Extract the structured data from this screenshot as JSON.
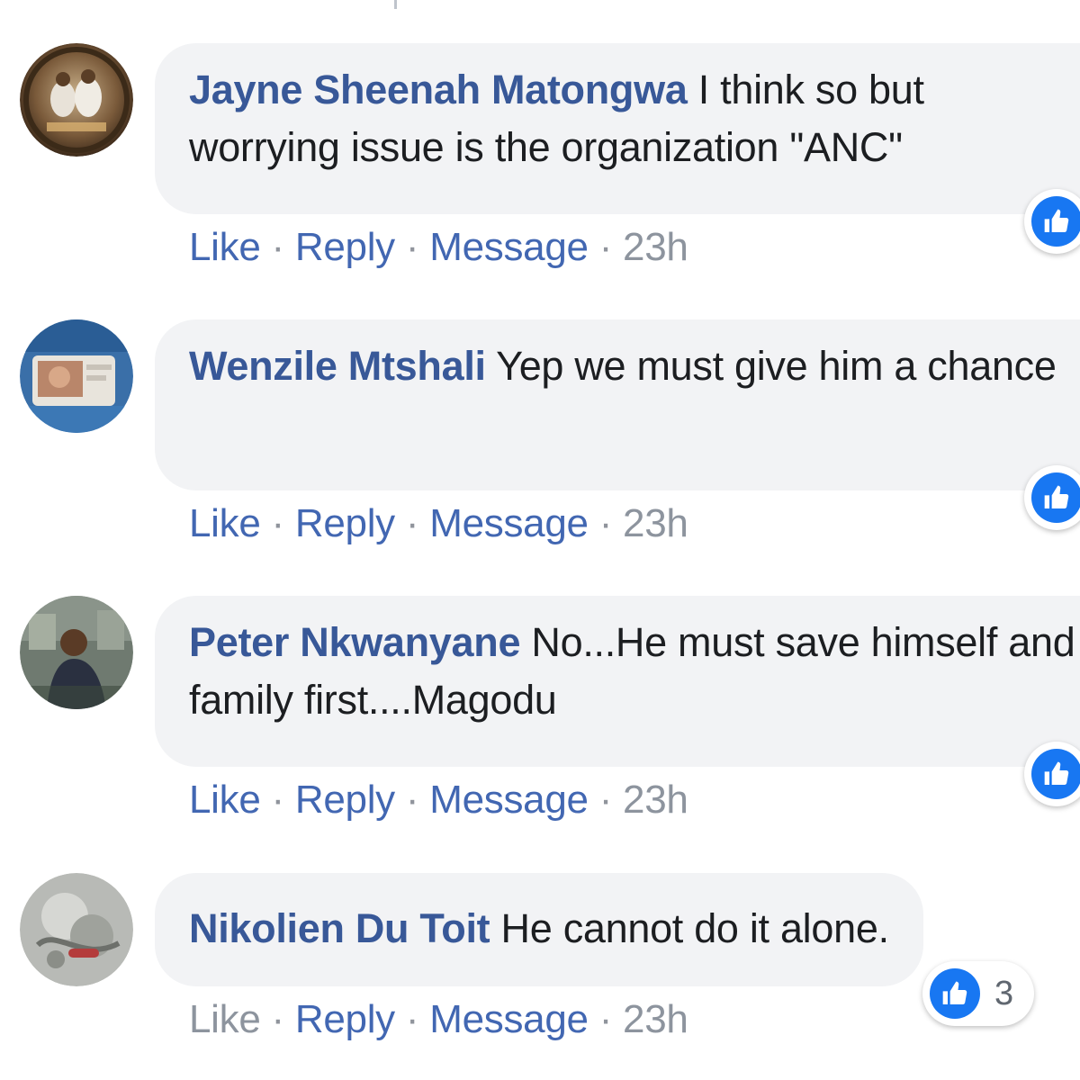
{
  "comments": [
    {
      "author": "Jayne Sheenah Matongwa",
      "text": " I think so but worrying issue is the organization \"ANC\"",
      "actions": {
        "like": "Like",
        "reply": "Reply",
        "message": "Message",
        "time": "23h"
      },
      "reaction_icon": "thumbs-up-icon"
    },
    {
      "author": "Wenzile Mtshali",
      "text": " Yep we must give him a chance",
      "actions": {
        "like": "Like",
        "reply": "Reply",
        "message": "Message",
        "time": "23h"
      },
      "reaction_icon": "thumbs-up-icon"
    },
    {
      "author": "Peter Nkwanyane",
      "text": " No...He must save himself and family first....Magodu",
      "actions": {
        "like": "Like",
        "reply": "Reply",
        "message": "Message",
        "time": "23h"
      },
      "reaction_icon": "thumbs-up-icon"
    },
    {
      "author": "Nikolien Du Toit",
      "text": " He cannot do it alone.",
      "actions": {
        "like": "Like",
        "reply": "Reply",
        "message": "Message",
        "time": "23h"
      },
      "reaction_icon": "thumbs-up-icon",
      "reaction_count": "3"
    }
  ],
  "separator": "·",
  "colors": {
    "author": "#385898",
    "action_link": "#4267b2",
    "bubble_bg": "#f2f3f5",
    "like_blue": "#1877f2",
    "meta_gray": "#8d949e"
  }
}
